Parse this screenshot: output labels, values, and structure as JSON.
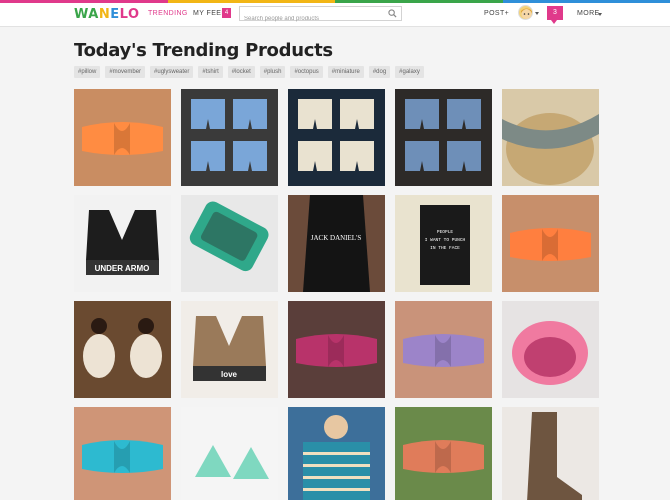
{
  "brand": {
    "logo_letters": [
      "W",
      "A",
      "N",
      "E",
      "L",
      "O"
    ],
    "logo_colors": [
      "#3aa54a",
      "#3aa54a",
      "#f2b616",
      "#2f8fd9",
      "#e0398b",
      "#e0398b"
    ],
    "stripe_colors": [
      "#e0398b",
      "#f2b616",
      "#3aa54a",
      "#2f8fd9"
    ]
  },
  "nav": {
    "trending": "TRENDING",
    "my_feed": "MY FEED",
    "feed_count": "4",
    "post": "POST+",
    "notifications": "3",
    "more": "MORE"
  },
  "search": {
    "placeholder": "Search people and products"
  },
  "page": {
    "title": "Today's Trending Products",
    "tags": [
      "#pillow",
      "#movember",
      "#uglysweater",
      "#tshirt",
      "#locket",
      "#plush",
      "#octopus",
      "#miniature",
      "#dog",
      "#galaxy"
    ]
  },
  "products": [
    {
      "name": "orange-twist-bandeau",
      "bg": "#c98d62",
      "accent": "#ff8c42"
    },
    {
      "name": "denim-shorts-collage",
      "bg": "#3a3a3a",
      "accent": "#7aa6d8"
    },
    {
      "name": "tribal-print-shorts",
      "bg": "#1b2a3a",
      "accent": "#e9e2d0"
    },
    {
      "name": "studded-denim-shorts",
      "bg": "#2d2a28",
      "accent": "#6e8fb8"
    },
    {
      "name": "aztec-headband",
      "bg": "#d9c9a8",
      "accent": "#7d8a86"
    },
    {
      "name": "sports-bra",
      "bg": "#f2f2f2",
      "accent": "#1d1d1d",
      "text": "UNDER ARMO"
    },
    {
      "name": "tribal-phone-case",
      "bg": "#e8e8e8",
      "accent": "#2fa88a"
    },
    {
      "name": "whiskey-tank-top",
      "bg": "#6b4b3a",
      "accent": "#141414",
      "text": "JACK DANIEL'S"
    },
    {
      "name": "punch-notebook",
      "bg": "#e9e3cf",
      "accent": "#1a1a1a",
      "text": "PEOPLE I WANT TO PUNCH IN THE FACE"
    },
    {
      "name": "orange-grey-bandeau",
      "bg": "#c78f6b",
      "accent": "#ff7f3f"
    },
    {
      "name": "oversized-sweater-girl",
      "bg": "#4a3324",
      "accent": "#ede3d4"
    },
    {
      "name": "love-infinity-bracelets",
      "bg": "#f1ede8",
      "accent": "#9a7a5a",
      "text": "love"
    },
    {
      "name": "sequin-bandeaus",
      "bg": "#5a3e3a",
      "accent": "#b8336a"
    },
    {
      "name": "lavender-grey-bandeau",
      "bg": "#c9937a",
      "accent": "#9c84c9"
    },
    {
      "name": "pink-egg-chair",
      "bg": "#e6e3e3",
      "accent": "#f07aa0"
    },
    {
      "name": "grey-teal-bandeau",
      "bg": "#cf9577",
      "accent": "#2dbad0"
    },
    {
      "name": "mint-triangle-earrings",
      "bg": "#f5f5f5",
      "accent": "#7fd8c0"
    },
    {
      "name": "aztec-sweater",
      "bg": "#3d6f9a",
      "accent": "#2a8fa8"
    },
    {
      "name": "two-girls-bandeaus",
      "bg": "#6a8a4a",
      "accent": "#e07c5a"
    },
    {
      "name": "lace-up-boots",
      "bg": "#ece8e4",
      "accent": "#6e5540"
    }
  ]
}
